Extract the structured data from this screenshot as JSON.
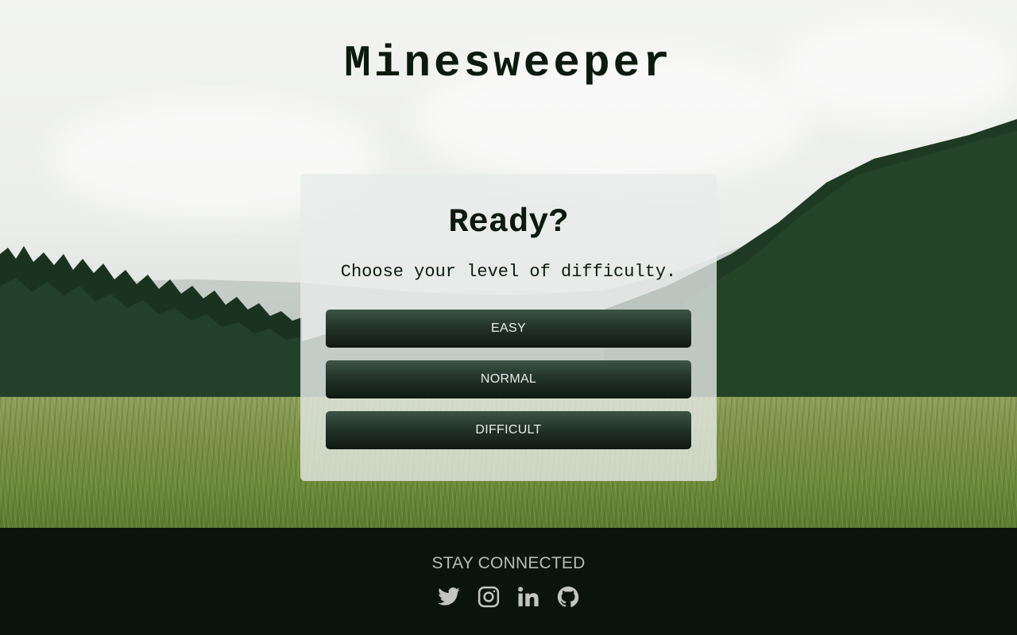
{
  "header": {
    "title": "Minesweeper"
  },
  "card": {
    "title": "Ready?",
    "subtitle": "Choose your level of difficulty.",
    "buttons": [
      {
        "label": "EASY"
      },
      {
        "label": "NORMAL"
      },
      {
        "label": "DIFFICULT"
      }
    ]
  },
  "footer": {
    "heading": "STAY CONNECTED",
    "social_icons": [
      "twitter-icon",
      "instagram-icon",
      "linkedin-icon",
      "github-icon"
    ]
  },
  "colors": {
    "title_text": "#0b1a0e",
    "button_top": "#3d5446",
    "button_bottom": "#0f1812",
    "footer_bg": "#0a140d",
    "footer_text": "#b7bcb8"
  }
}
